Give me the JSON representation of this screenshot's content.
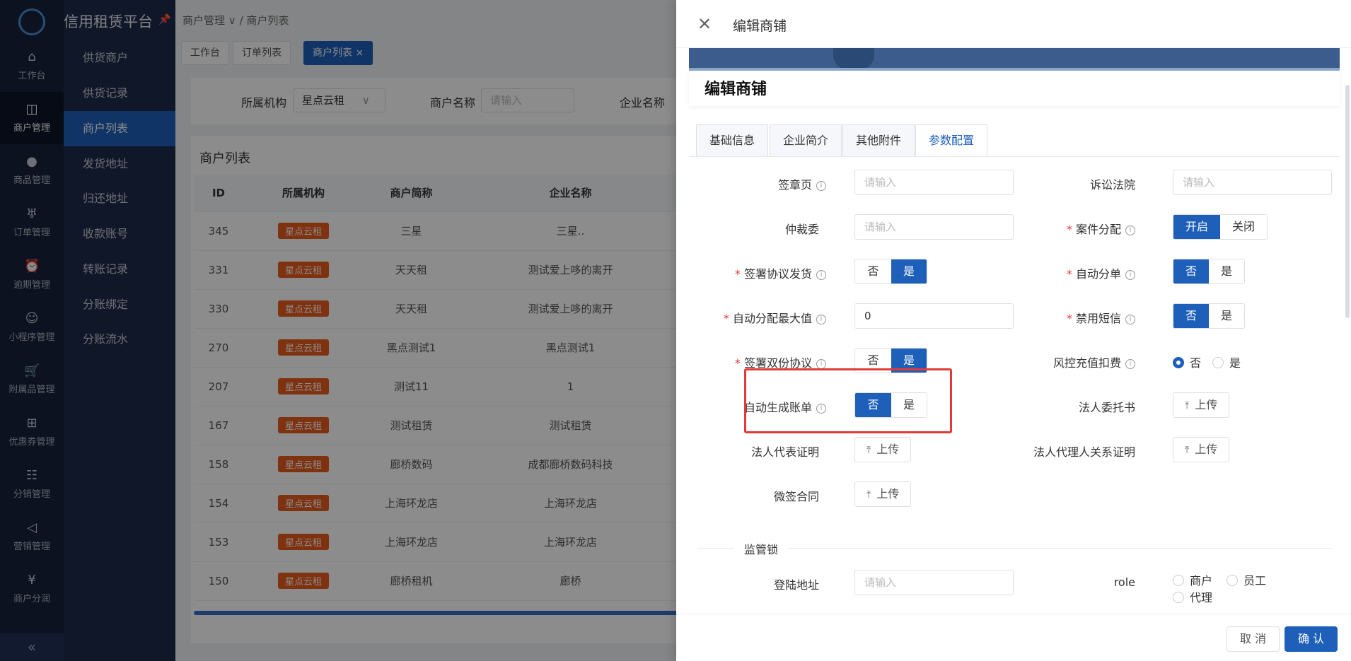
{
  "app": {
    "title": "信用租赁平台"
  },
  "rail": [
    {
      "label": "工作台",
      "icon": "home-icon"
    },
    {
      "label": "商户管理",
      "icon": "bag-icon",
      "active": true
    },
    {
      "label": "商品管理",
      "icon": "apple-icon"
    },
    {
      "label": "订单管理",
      "icon": "trophy-icon"
    },
    {
      "label": "逾期管理",
      "icon": "alarm-icon"
    },
    {
      "label": "小程序管理",
      "icon": "robot-icon"
    },
    {
      "label": "附属品管理",
      "icon": "cart-icon"
    },
    {
      "label": "优惠券管理",
      "icon": "gift-icon"
    },
    {
      "label": "分销管理",
      "icon": "sliders-icon"
    },
    {
      "label": "营销管理",
      "icon": "megaphone-icon"
    },
    {
      "label": "商户分润",
      "icon": "yen-icon"
    }
  ],
  "sidebar": {
    "items": [
      "供货商户",
      "供货记录",
      "商户列表",
      "发货地址",
      "归还地址",
      "收款账号",
      "转账记录",
      "分账绑定",
      "分账流水"
    ]
  },
  "breadcrumb": {
    "parent": "商户管理",
    "current": "商户列表"
  },
  "tabs": [
    "工作台",
    "订单列表",
    "商户列表"
  ],
  "filter": {
    "org_label": "所属机构",
    "org_value": "星点云租",
    "name_label": "商户名称",
    "name_placeholder": "请输入",
    "company_label": "企业名称"
  },
  "list": {
    "title": "商户列表",
    "columns": [
      "ID",
      "所属机构",
      "商户简称",
      "企业名称"
    ],
    "rows": [
      [
        "345",
        "星点云租",
        "三星",
        "三星.."
      ],
      [
        "331",
        "星点云租",
        "天天租",
        "测试爱上哆的离开"
      ],
      [
        "330",
        "星点云租",
        "天天租",
        "测试爱上哆的离开"
      ],
      [
        "270",
        "星点云租",
        "黑点测试1",
        "黑点测试1"
      ],
      [
        "207",
        "星点云租",
        "测试11",
        "1"
      ],
      [
        "167",
        "星点云租",
        "测试租赁",
        "测试租赁"
      ],
      [
        "158",
        "星点云租",
        "廊桥数码",
        "成都廊桥数码科技"
      ],
      [
        "154",
        "星点云租",
        "上海环龙店",
        "上海环龙店"
      ],
      [
        "153",
        "星点云租",
        "上海环龙店",
        "上海环龙店"
      ],
      [
        "150",
        "星点云租",
        "廊桥租机",
        "廊桥"
      ]
    ]
  },
  "drawer": {
    "title": "编辑商铺",
    "shop_title": "编辑商铺",
    "tabs": [
      "基础信息",
      "企业简介",
      "其他附件",
      "参数配置"
    ],
    "fields": {
      "sign_page": {
        "label": "签章页",
        "placeholder": "请输入"
      },
      "court": {
        "label": "诉讼法院",
        "placeholder": "请输入"
      },
      "arbitration": {
        "label": "仲裁委",
        "placeholder": "请输入"
      },
      "case_assign": {
        "label": "案件分配",
        "options": [
          "开启",
          "关闭"
        ],
        "selected": "开启"
      },
      "sign_ship": {
        "label": "签署协议发货",
        "options": [
          "否",
          "是"
        ],
        "selected": "是"
      },
      "auto_split": {
        "label": "自动分单",
        "options": [
          "否",
          "是"
        ],
        "selected": "否"
      },
      "auto_max": {
        "label": "自动分配最大值",
        "value": "0"
      },
      "disable_sms": {
        "label": "禁用短信",
        "options": [
          "否",
          "是"
        ],
        "selected": "否"
      },
      "sign_double": {
        "label": "签署双份协议",
        "options": [
          "否",
          "是"
        ],
        "selected": "是"
      },
      "risk_fee": {
        "label": "风控充值扣费",
        "options": [
          "否",
          "是"
        ],
        "selected": "否"
      },
      "auto_bill": {
        "label": "自动生成账单",
        "options": [
          "否",
          "是"
        ],
        "selected": "否"
      },
      "legal_entrust": {
        "label": "法人委托书",
        "button": "上传"
      },
      "legal_proof": {
        "label": "法人代表证明",
        "button": "上传"
      },
      "agent_relation": {
        "label": "法人代理人关系证明",
        "button": "上传"
      },
      "micro_sign": {
        "label": "微签合同",
        "button": "上传"
      }
    },
    "section": "监管锁",
    "login_addr": {
      "label": "登陆地址",
      "placeholder": "请输入"
    },
    "role": {
      "label": "role",
      "options": [
        "商户",
        "员工",
        "代理"
      ]
    },
    "footer": {
      "cancel": "取 消",
      "confirm": "确 认"
    }
  },
  "colors": {
    "primary": "#1d5fb9",
    "tag": "#e85b1e",
    "highlight": "#e53935",
    "rail_bg": "#16213a",
    "sidebar_bg": "#1e2b4a"
  }
}
